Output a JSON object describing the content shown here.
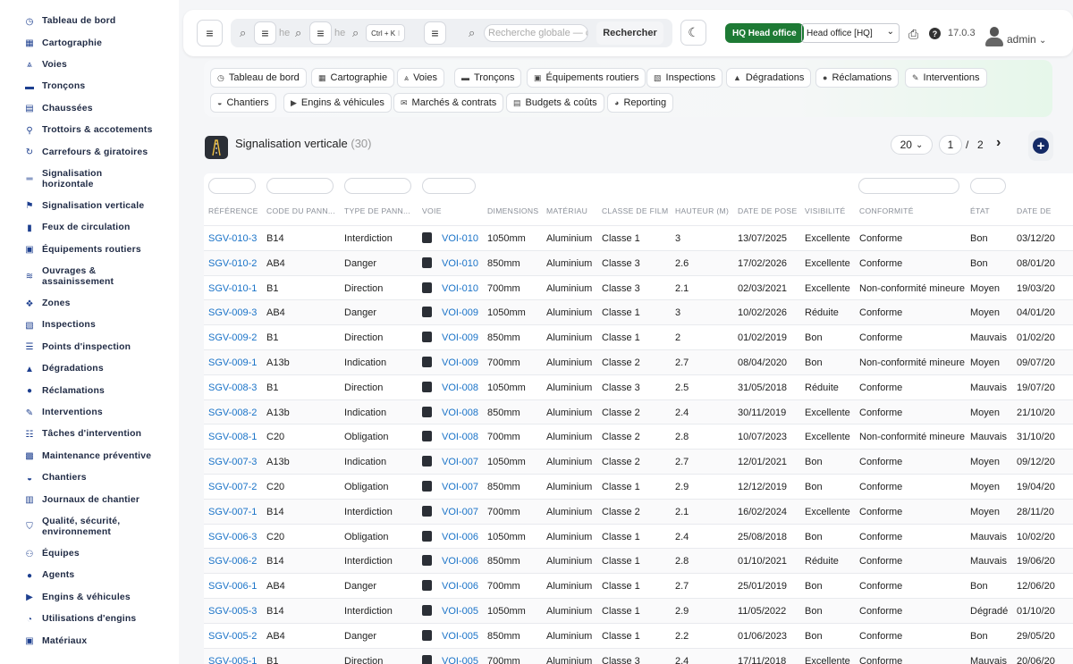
{
  "sidebar": {
    "items": [
      {
        "label": "Tableau de bord",
        "icon": "dashboard-icon",
        "glyph": "◷"
      },
      {
        "label": "Cartographie",
        "icon": "map-icon",
        "glyph": "▦"
      },
      {
        "label": "Voies",
        "icon": "road-icon",
        "glyph": "⩓"
      },
      {
        "label": "Tronçons",
        "icon": "segment-icon",
        "glyph": "▬"
      },
      {
        "label": "Chaussées",
        "icon": "pavement-icon",
        "glyph": "▤"
      },
      {
        "label": "Trottoirs & accotements",
        "icon": "sidewalk-icon",
        "glyph": "⚲"
      },
      {
        "label": "Carrefours & giratoires",
        "icon": "roundabout-icon",
        "glyph": "↻"
      },
      {
        "label": "Signalisation horizontale",
        "icon": "marking-icon",
        "glyph": "═"
      },
      {
        "label": "Signalisation verticale",
        "icon": "sign-icon",
        "glyph": "⚑"
      },
      {
        "label": "Feux de circulation",
        "icon": "traffic-light-icon",
        "glyph": "▮"
      },
      {
        "label": "Équipements routiers",
        "icon": "equipment-icon",
        "glyph": "▣"
      },
      {
        "label": "Ouvrages & assainissement",
        "icon": "drainage-icon",
        "glyph": "≋"
      },
      {
        "label": "Zones",
        "icon": "zones-icon",
        "glyph": "❖"
      },
      {
        "label": "Inspections",
        "icon": "inspection-icon",
        "glyph": "▧"
      },
      {
        "label": "Points d'inspection",
        "icon": "list-icon",
        "glyph": "☰"
      },
      {
        "label": "Dégradations",
        "icon": "warning-icon",
        "glyph": "▲"
      },
      {
        "label": "Réclamations",
        "icon": "comment-icon",
        "glyph": "●"
      },
      {
        "label": "Interventions",
        "icon": "wrench-icon",
        "glyph": "✎"
      },
      {
        "label": "Tâches d'intervention",
        "icon": "tasks-icon",
        "glyph": "☷"
      },
      {
        "label": "Maintenance préventive",
        "icon": "calendar-icon",
        "glyph": "▩"
      },
      {
        "label": "Chantiers",
        "icon": "helmet-icon",
        "glyph": "◒"
      },
      {
        "label": "Journaux de chantier",
        "icon": "journal-icon",
        "glyph": "▥"
      },
      {
        "label": "Qualité, sécurité, environnement",
        "icon": "shield-icon",
        "glyph": "⛉"
      },
      {
        "label": "Équipes",
        "icon": "users-icon",
        "glyph": "⚇"
      },
      {
        "label": "Agents",
        "icon": "user-icon",
        "glyph": "●"
      },
      {
        "label": "Engins & véhicules",
        "icon": "truck-icon",
        "glyph": "▶"
      },
      {
        "label": "Utilisations d'engins",
        "icon": "clock-icon",
        "glyph": "◔"
      },
      {
        "label": "Matériaux",
        "icon": "box-icon",
        "glyph": "▣"
      }
    ]
  },
  "topbar": {
    "menu_glyph": "≡",
    "search_glyph": "⌕",
    "search1_placeholder": "he",
    "search2_placeholder": "he",
    "shortcut": "Ctrl + K",
    "shortcut_tail": "l",
    "global_search_placeholder": "Recherche globale — c",
    "search_button": "Rechercher",
    "theme_glyph": "☾",
    "hq_badge": "HQ Head office",
    "hq_select": "Head office [HQ]",
    "hq_select_chevron": "⌄",
    "print_glyph": "⎙",
    "help_glyph": "?",
    "version": "17.0.3",
    "user": "admin",
    "user_chevron": "⌄"
  },
  "modules": [
    {
      "label": "Tableau de bord",
      "glyph": "◷"
    },
    {
      "label": "Cartographie",
      "glyph": "▦"
    },
    {
      "label": "Voies",
      "glyph": "⩓"
    },
    {
      "label": "Tronçons",
      "glyph": "▬"
    },
    {
      "label": "Équipements routiers",
      "glyph": "▣"
    },
    {
      "label": "Inspections",
      "glyph": "▧"
    },
    {
      "label": "Dégradations",
      "glyph": "▲"
    },
    {
      "label": "Réclamations",
      "glyph": "●"
    },
    {
      "label": "Interventions",
      "glyph": "✎"
    },
    {
      "label": "Chantiers",
      "glyph": "◒"
    },
    {
      "label": "Engins & véhicules",
      "glyph": "▶"
    },
    {
      "label": "Marchés & contrats",
      "glyph": "✉"
    },
    {
      "label": "Budgets & coûts",
      "glyph": "▤"
    },
    {
      "label": "Reporting",
      "glyph": "◕"
    }
  ],
  "page": {
    "title": "Signalisation verticale",
    "count": "(30)",
    "page_size": "20",
    "page_size_chevron": "⌄",
    "current_page": "1",
    "page_sep": "/",
    "total_pages": "2",
    "next_glyph": "›",
    "add_glyph": "+"
  },
  "table": {
    "headers": [
      "RÉFÉRENCE",
      "CODE DU PANN...",
      "TYPE DE PANN...",
      "VOIE",
      "DIMENSIONS",
      "MATÉRIAU",
      "CLASSE DE FILM",
      "HAUTEUR (M)",
      "DATE DE POSE",
      "VISIBILITÉ",
      "CONFORMITÉ",
      "ÉTAT",
      "DATE DE"
    ],
    "rows": [
      [
        "SGV-010-3",
        "B14",
        "Interdiction",
        "VOI-010",
        "1050mm",
        "Aluminium",
        "Classe 1",
        "3",
        "13/07/2025",
        "Excellente",
        "Conforme",
        "Bon",
        "03/12/20"
      ],
      [
        "SGV-010-2",
        "AB4",
        "Danger",
        "VOI-010",
        "850mm",
        "Aluminium",
        "Classe 3",
        "2.6",
        "17/02/2026",
        "Excellente",
        "Conforme",
        "Bon",
        "08/01/20"
      ],
      [
        "SGV-010-1",
        "B1",
        "Direction",
        "VOI-010",
        "700mm",
        "Aluminium",
        "Classe 3",
        "2.1",
        "02/03/2021",
        "Excellente",
        "Non-conformité mineure",
        "Moyen",
        "19/03/20"
      ],
      [
        "SGV-009-3",
        "AB4",
        "Danger",
        "VOI-009",
        "1050mm",
        "Aluminium",
        "Classe 1",
        "3",
        "10/02/2026",
        "Réduite",
        "Conforme",
        "Moyen",
        "04/01/20"
      ],
      [
        "SGV-009-2",
        "B1",
        "Direction",
        "VOI-009",
        "850mm",
        "Aluminium",
        "Classe 1",
        "2",
        "01/02/2019",
        "Bon",
        "Conforme",
        "Mauvais",
        "01/02/20"
      ],
      [
        "SGV-009-1",
        "A13b",
        "Indication",
        "VOI-009",
        "700mm",
        "Aluminium",
        "Classe 2",
        "2.7",
        "08/04/2020",
        "Bon",
        "Non-conformité mineure",
        "Moyen",
        "09/07/20"
      ],
      [
        "SGV-008-3",
        "B1",
        "Direction",
        "VOI-008",
        "1050mm",
        "Aluminium",
        "Classe 3",
        "2.5",
        "31/05/2018",
        "Réduite",
        "Conforme",
        "Mauvais",
        "19/07/20"
      ],
      [
        "SGV-008-2",
        "A13b",
        "Indication",
        "VOI-008",
        "850mm",
        "Aluminium",
        "Classe 2",
        "2.4",
        "30/11/2019",
        "Excellente",
        "Conforme",
        "Moyen",
        "21/10/20"
      ],
      [
        "SGV-008-1",
        "C20",
        "Obligation",
        "VOI-008",
        "700mm",
        "Aluminium",
        "Classe 2",
        "2.8",
        "10/07/2023",
        "Excellente",
        "Non-conformité mineure",
        "Mauvais",
        "31/10/20"
      ],
      [
        "SGV-007-3",
        "A13b",
        "Indication",
        "VOI-007",
        "1050mm",
        "Aluminium",
        "Classe 2",
        "2.7",
        "12/01/2021",
        "Bon",
        "Conforme",
        "Moyen",
        "09/12/20"
      ],
      [
        "SGV-007-2",
        "C20",
        "Obligation",
        "VOI-007",
        "850mm",
        "Aluminium",
        "Classe 1",
        "2.9",
        "12/12/2019",
        "Bon",
        "Conforme",
        "Moyen",
        "19/04/20"
      ],
      [
        "SGV-007-1",
        "B14",
        "Interdiction",
        "VOI-007",
        "700mm",
        "Aluminium",
        "Classe 2",
        "2.1",
        "16/02/2024",
        "Excellente",
        "Conforme",
        "Moyen",
        "28/11/20"
      ],
      [
        "SGV-006-3",
        "C20",
        "Obligation",
        "VOI-006",
        "1050mm",
        "Aluminium",
        "Classe 1",
        "2.4",
        "25/08/2018",
        "Bon",
        "Conforme",
        "Mauvais",
        "10/02/20"
      ],
      [
        "SGV-006-2",
        "B14",
        "Interdiction",
        "VOI-006",
        "850mm",
        "Aluminium",
        "Classe 1",
        "2.8",
        "01/10/2021",
        "Réduite",
        "Conforme",
        "Mauvais",
        "19/06/20"
      ],
      [
        "SGV-006-1",
        "AB4",
        "Danger",
        "VOI-006",
        "700mm",
        "Aluminium",
        "Classe 1",
        "2.7",
        "25/01/2019",
        "Bon",
        "Conforme",
        "Bon",
        "12/06/20"
      ],
      [
        "SGV-005-3",
        "B14",
        "Interdiction",
        "VOI-005",
        "1050mm",
        "Aluminium",
        "Classe 1",
        "2.9",
        "11/05/2022",
        "Bon",
        "Conforme",
        "Dégradé",
        "01/10/20"
      ],
      [
        "SGV-005-2",
        "AB4",
        "Danger",
        "VOI-005",
        "850mm",
        "Aluminium",
        "Classe 1",
        "2.2",
        "01/06/2023",
        "Bon",
        "Conforme",
        "Bon",
        "29/05/20"
      ],
      [
        "SGV-005-1",
        "B1",
        "Direction",
        "VOI-005",
        "700mm",
        "Aluminium",
        "Classe 3",
        "2.4",
        "17/11/2018",
        "Excellente",
        "Conforme",
        "Mauvais",
        "20/06/20"
      ]
    ]
  },
  "colors": {
    "link": "#1a73c8",
    "hq_badge": "#1e7a35",
    "sidebar_text": "#1f2a44",
    "sidebar_icon": "#1d3f8f",
    "add_button": "#142a66"
  }
}
